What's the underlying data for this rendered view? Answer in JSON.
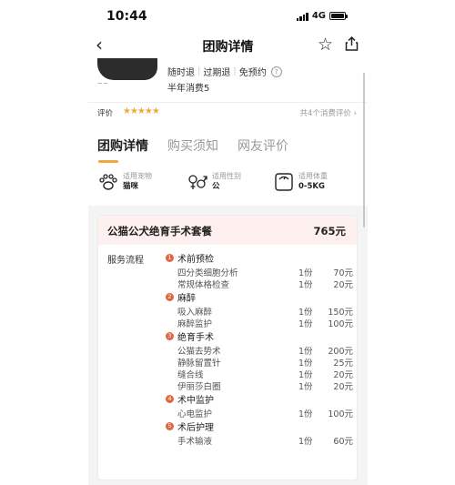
{
  "status_bar": {
    "time": "10:44",
    "network": "4G"
  },
  "nav": {
    "back_icon": "chevron-left",
    "title": "团购详情",
    "favorite_icon": "star-outline",
    "share_icon": "share"
  },
  "header": {
    "policies": [
      "随时退",
      "过期退",
      "免预约"
    ],
    "help_icon": "question-circle",
    "sales": "半年消费5"
  },
  "rating": {
    "label": "评价",
    "stars": 5,
    "stars_text": "★★★★★",
    "more": "共4个消费评价",
    "more_icon": "chevron-right"
  },
  "tabs": [
    {
      "label": "团购详情",
      "active": true
    },
    {
      "label": "购买须知",
      "active": false
    },
    {
      "label": "网友评价",
      "active": false
    }
  ],
  "attributes": [
    {
      "label": "适用宠物",
      "value": "猫咪",
      "icon": "paw"
    },
    {
      "label": "适用性别",
      "value": "公",
      "icon": "gender"
    },
    {
      "label": "适用体重",
      "value": "0-5KG",
      "icon": "scale"
    }
  ],
  "package": {
    "name": "公猫公犬绝育手术套餐",
    "price": "765元",
    "flow_label": "服务流程",
    "groups": [
      {
        "num": "1",
        "name": "术前预检",
        "items": [
          {
            "name": "四分类细胞分析",
            "qty": "1份",
            "price": "70元"
          },
          {
            "name": "常规体格检查",
            "qty": "1份",
            "price": "20元"
          }
        ]
      },
      {
        "num": "2",
        "name": "麻醉",
        "items": [
          {
            "name": "吸入麻醉",
            "qty": "1份",
            "price": "150元"
          },
          {
            "name": "麻醉监护",
            "qty": "1份",
            "price": "100元"
          }
        ]
      },
      {
        "num": "3",
        "name": "绝育手术",
        "items": [
          {
            "name": "公猫去势术",
            "qty": "1份",
            "price": "200元"
          },
          {
            "name": "静脉留置针",
            "qty": "1份",
            "price": "25元"
          },
          {
            "name": "缝合线",
            "qty": "1份",
            "price": "20元"
          },
          {
            "name": "伊丽莎白圈",
            "qty": "1份",
            "price": "20元"
          }
        ]
      },
      {
        "num": "4",
        "name": "术中监护",
        "items": [
          {
            "name": "心电监护",
            "qty": "1份",
            "price": "100元"
          }
        ]
      },
      {
        "num": "5",
        "name": "术后护理",
        "items": [
          {
            "name": "手术输液",
            "qty": "1份",
            "price": "60元"
          }
        ]
      }
    ]
  }
}
